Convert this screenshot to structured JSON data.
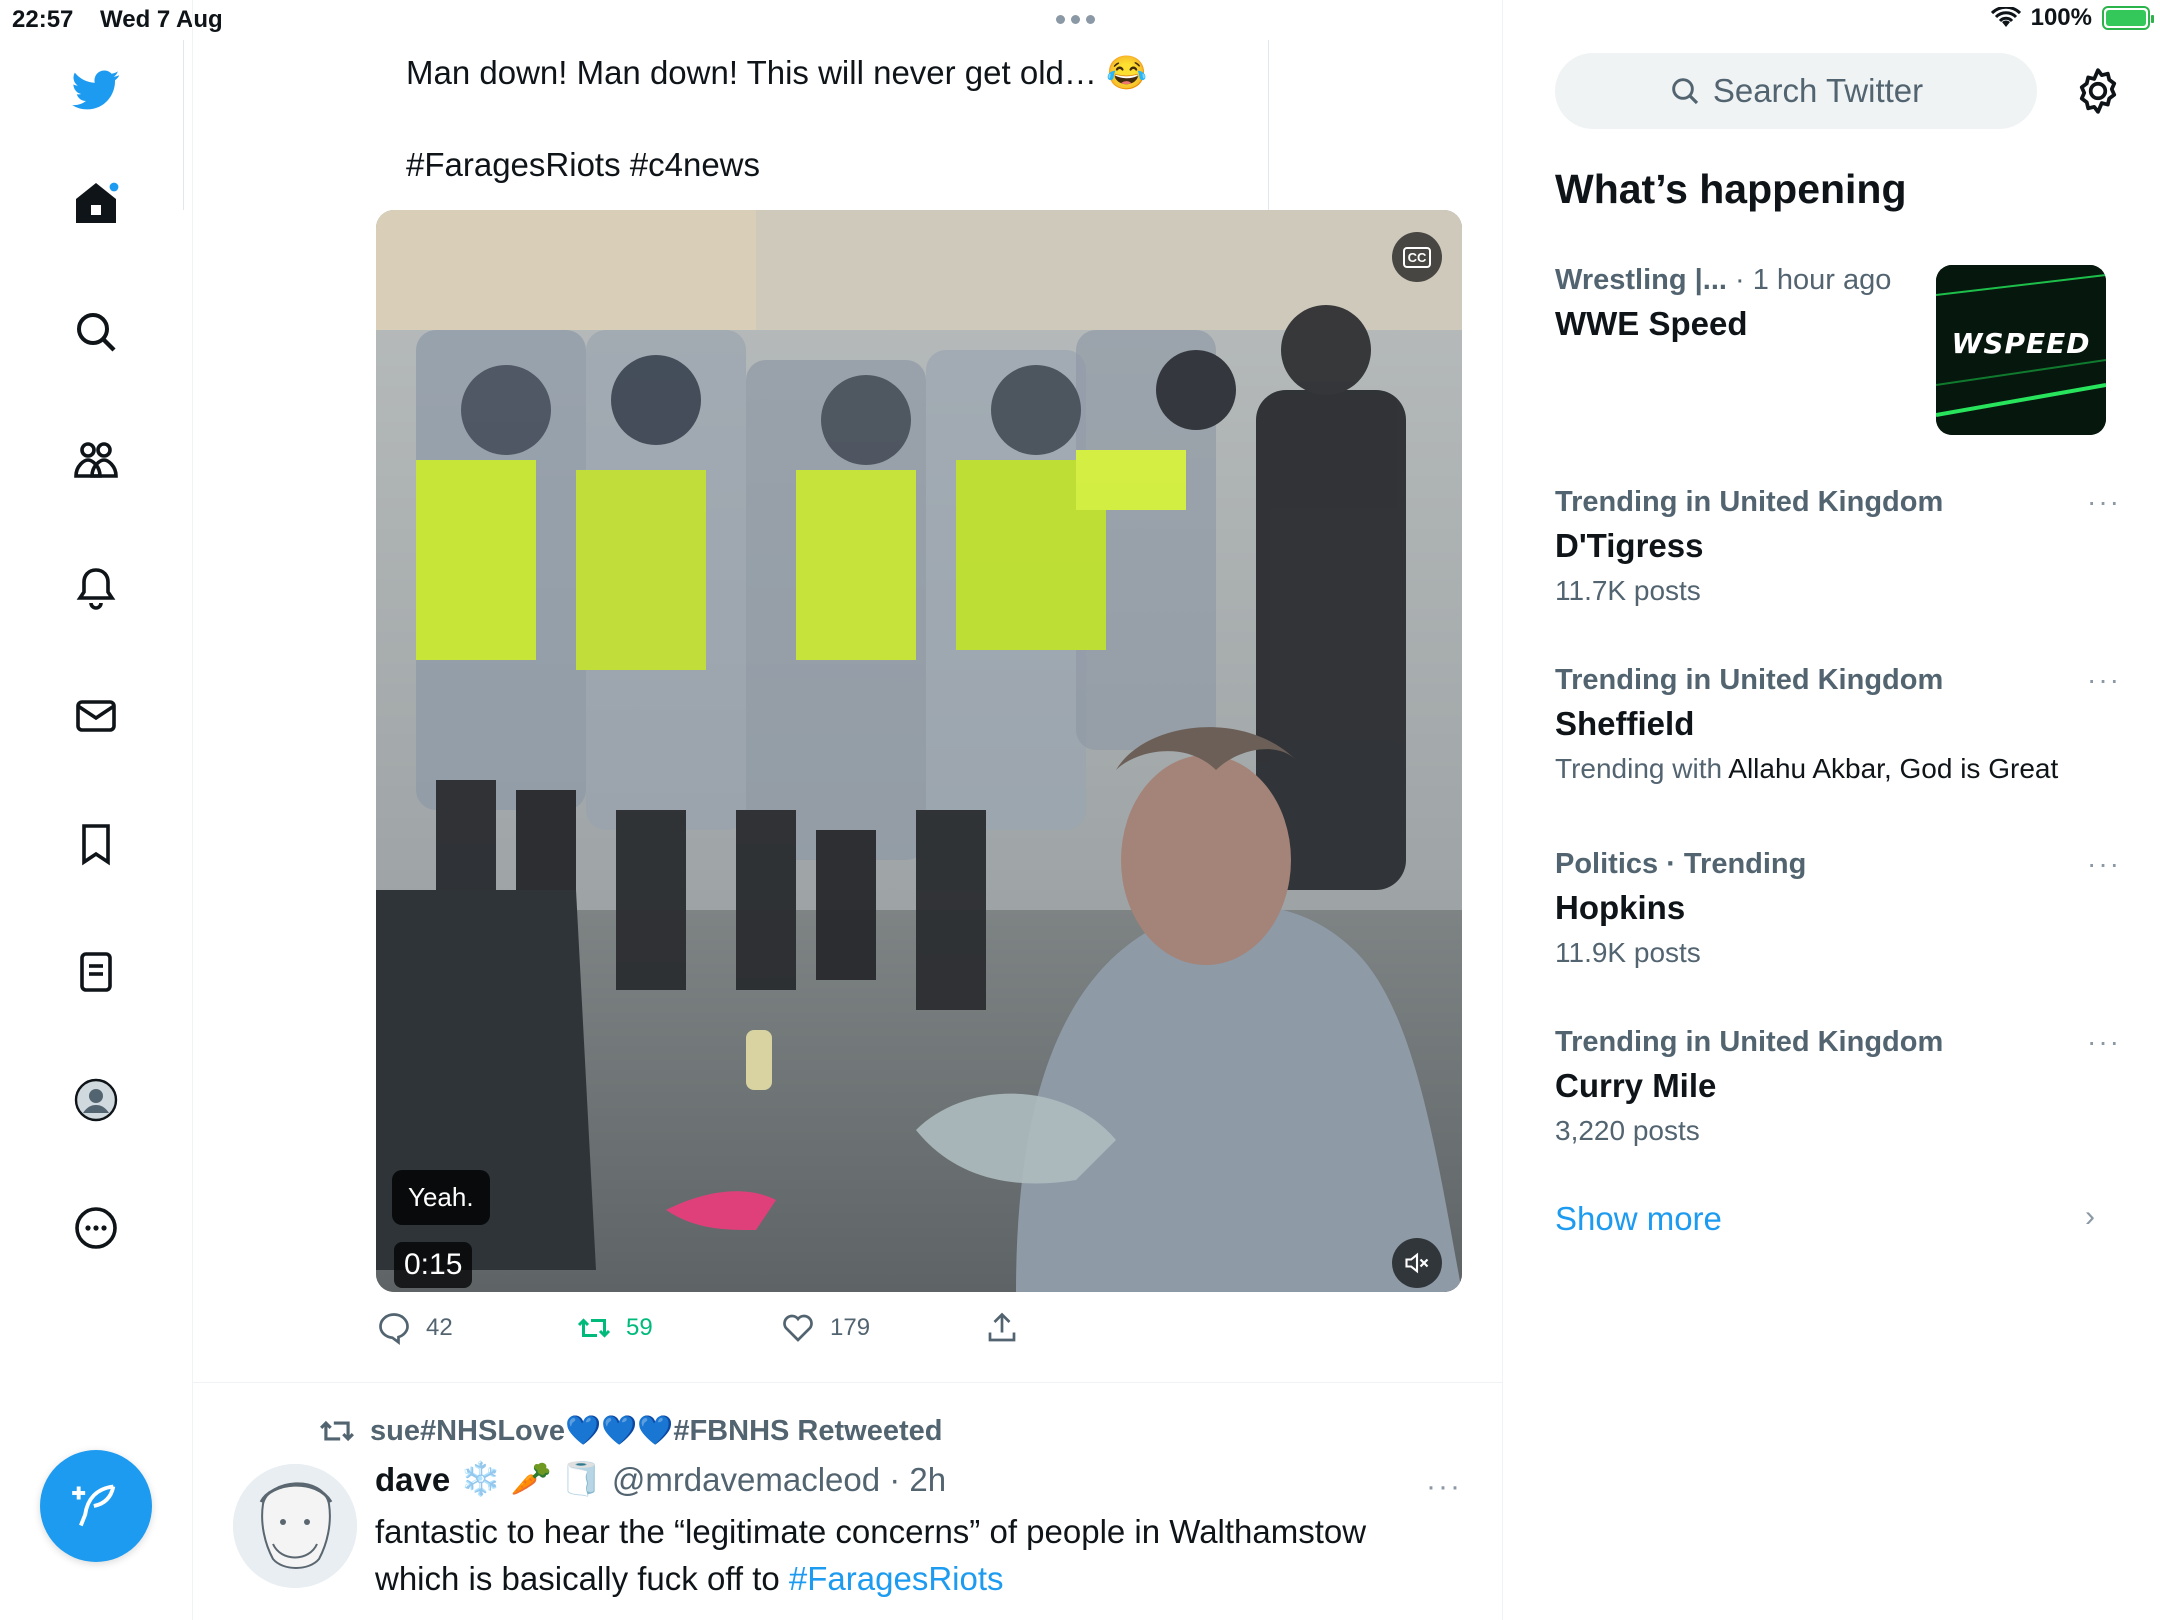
{
  "status_bar": {
    "time": "22:57",
    "date": "Wed 7 Aug",
    "battery": "100%"
  },
  "nav": {
    "items": [
      "home-icon",
      "explore-icon",
      "communities-icon",
      "notifications-icon",
      "messages-icon",
      "bookmarks-icon",
      "lists-icon",
      "profile-icon",
      "more-icon"
    ],
    "compose": "compose-tweet-icon"
  },
  "tweet": {
    "text_line1": "Man down!  Man down! This will never get old… 😂",
    "text_line2": "#FaragesRiots #c4news",
    "video": {
      "cc_label": "CC",
      "caption": "Yeah.",
      "duration": "0:15"
    },
    "replies": "42",
    "retweets": "59",
    "likes": "179"
  },
  "tweet2": {
    "retweeted_by": "sue#NHSLove💙💙💙#FBNHS Retweeted",
    "author_name": "dave",
    "author_emoji": "❄️ 🥕 🧻",
    "handle_time": "@mrdavemacleod · 2h",
    "more": "···",
    "body": "fantastic to hear the “legitimate concerns” of people in Walthamstow which is basically fuck off to ",
    "hashtag": "#FaragesRiots"
  },
  "sidebar": {
    "search_placeholder": "Search Twitter",
    "title": "What’s happening",
    "trends": [
      {
        "meta": "Wrestling |...",
        "time": "· 1 hour ago",
        "name": "WWE Speed",
        "thumb_text": "WSPEED"
      },
      {
        "meta": "Trending in United Kingdom",
        "name": "D'Tigress",
        "sub": "11.7K posts"
      },
      {
        "meta": "Trending in United Kingdom",
        "name": "Sheffield",
        "sub_prefix": "Trending with ",
        "sub_dark": "Allahu Akbar, God is Great"
      },
      {
        "meta": "Politics · Trending",
        "name": "Hopkins",
        "sub": "11.9K posts"
      },
      {
        "meta": "Trending in United Kingdom",
        "name": "Curry Mile",
        "sub": "3,220 posts"
      }
    ],
    "show_more": "Show more",
    "chevron": "›",
    "more": "···"
  },
  "colors": {
    "twitter_blue": "#1d9bf0",
    "retweet_green": "#00ba7c",
    "secondary_text": "#536471"
  }
}
